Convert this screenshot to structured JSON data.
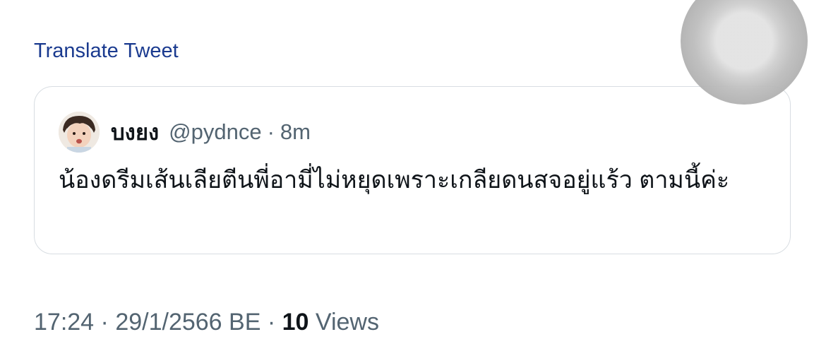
{
  "translate": {
    "label": "Translate Tweet"
  },
  "quote": {
    "author_name": "บงยง",
    "handle": "@pydnce",
    "separator": "·",
    "age": "8m",
    "text": "น้องดรีมเส้นเลียตีนพี่อามี่ไม่หยุดเพราะเกลียดนสจอยู่แร้ว ตามนี้ค่ะ"
  },
  "meta": {
    "time": "17:24",
    "sep1": "·",
    "date": "29/1/2566 BE",
    "sep2": "·",
    "views_count": "10",
    "views_label": "Views"
  },
  "icons": {
    "avatar": "user-avatar-photo",
    "touch": "touch-indicator"
  },
  "colors": {
    "link": "#1a3a8f",
    "text_primary": "#0f1419",
    "text_secondary": "#536471",
    "border": "#d8dde2"
  }
}
